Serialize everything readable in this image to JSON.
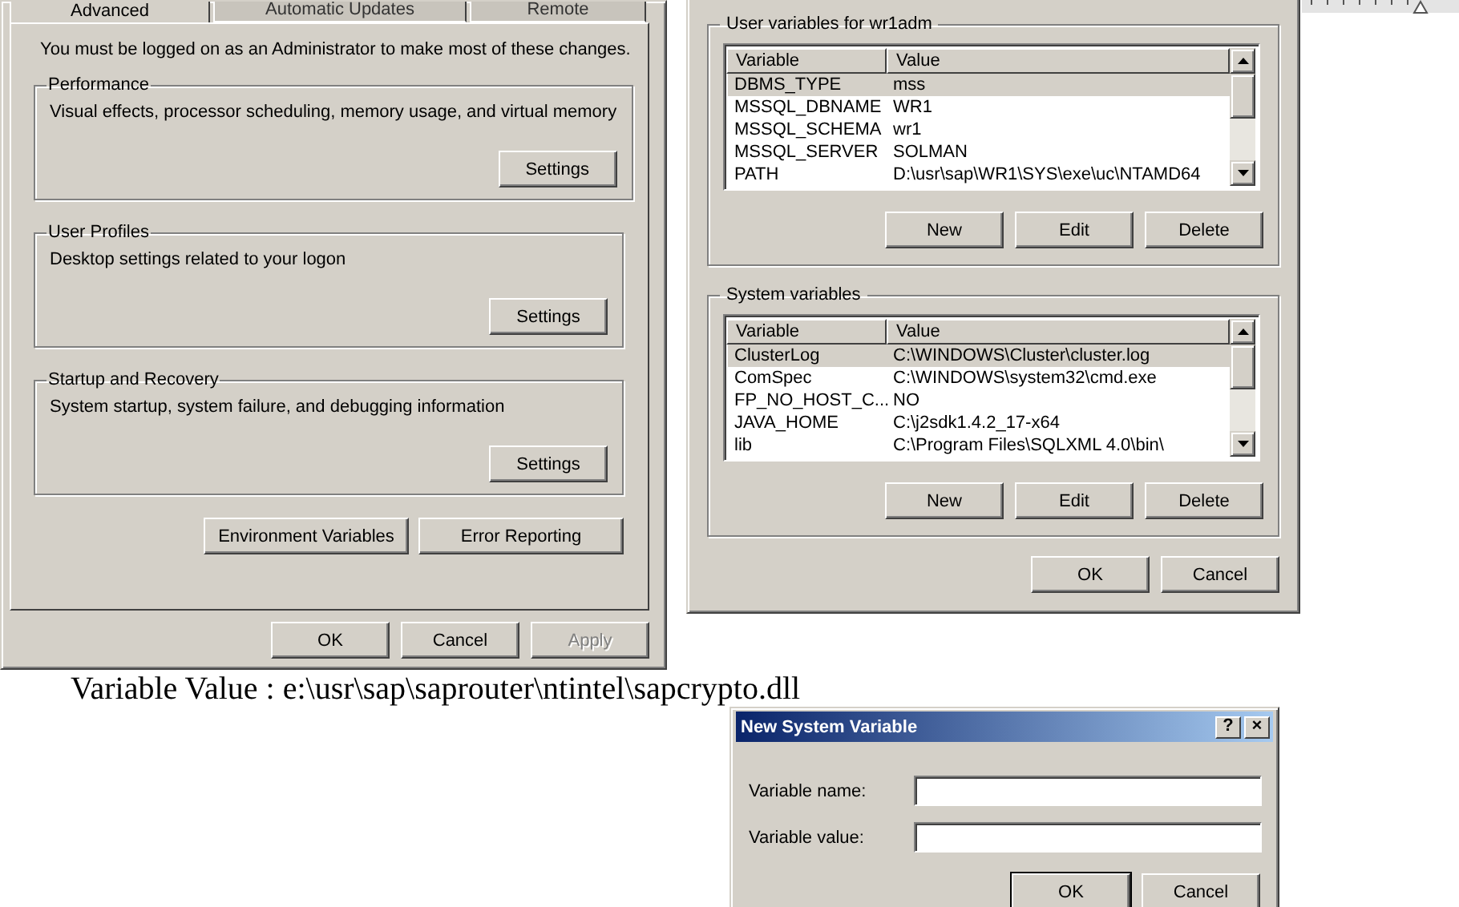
{
  "document": {
    "text": "Variable Value : e:\\usr\\sap\\saprouter\\ntintel\\sapcrypto.dll"
  },
  "system_properties": {
    "tabs": [
      {
        "label": "Advanced",
        "selected": true
      },
      {
        "label": "Automatic Updates",
        "selected": false
      },
      {
        "label": "Remote",
        "selected": false
      }
    ],
    "notice": "You must be logged on as an Administrator to make most of these changes.",
    "groups": [
      {
        "title": "Performance",
        "description": "Visual effects, processor scheduling, memory usage, and virtual memory",
        "button": "Settings"
      },
      {
        "title": "User Profiles",
        "description": "Desktop settings related to your logon",
        "button": "Settings"
      },
      {
        "title": "Startup and Recovery",
        "description": "System startup, system failure, and debugging information",
        "button": "Settings"
      }
    ],
    "actions": [
      "Environment Variables",
      "Error Reporting"
    ],
    "footer_buttons": [
      {
        "label": "OK",
        "disabled": false
      },
      {
        "label": "Cancel",
        "disabled": false
      },
      {
        "label": "Apply",
        "disabled": true
      }
    ]
  },
  "environment_variables": {
    "sections": [
      {
        "title": "User variables for wr1adm",
        "columns": [
          "Variable",
          "Value"
        ],
        "rows": [
          {
            "variable": "DBMS_TYPE",
            "value": "mss",
            "selected": true
          },
          {
            "variable": "MSSQL_DBNAME",
            "value": "WR1",
            "selected": false
          },
          {
            "variable": "MSSQL_SCHEMA",
            "value": "wr1",
            "selected": false
          },
          {
            "variable": "MSSQL_SERVER",
            "value": "SOLMAN",
            "selected": false
          },
          {
            "variable": "PATH",
            "value": "D:\\usr\\sap\\WR1\\SYS\\exe\\uc\\NTAMD64",
            "selected": false
          }
        ],
        "buttons": [
          "New",
          "Edit",
          "Delete"
        ]
      },
      {
        "title": "System variables",
        "columns": [
          "Variable",
          "Value"
        ],
        "rows": [
          {
            "variable": "ClusterLog",
            "value": "C:\\WINDOWS\\Cluster\\cluster.log",
            "selected": true
          },
          {
            "variable": "ComSpec",
            "value": "C:\\WINDOWS\\system32\\cmd.exe",
            "selected": false
          },
          {
            "variable": "FP_NO_HOST_C...",
            "value": "NO",
            "selected": false
          },
          {
            "variable": "JAVA_HOME",
            "value": "C:\\j2sdk1.4.2_17-x64",
            "selected": false
          },
          {
            "variable": "lib",
            "value": "C:\\Program Files\\SQLXML 4.0\\bin\\",
            "selected": false
          }
        ],
        "buttons": [
          "New",
          "Edit",
          "Delete"
        ]
      }
    ],
    "buttons": [
      "OK",
      "Cancel"
    ]
  },
  "new_variable_dialog": {
    "title": "New System Variable",
    "title_buttons": [
      "?",
      "×"
    ],
    "fields": [
      {
        "label": "Variable name:"
      },
      {
        "label": "Variable value:"
      }
    ],
    "buttons": [
      "OK",
      "Cancel"
    ]
  }
}
